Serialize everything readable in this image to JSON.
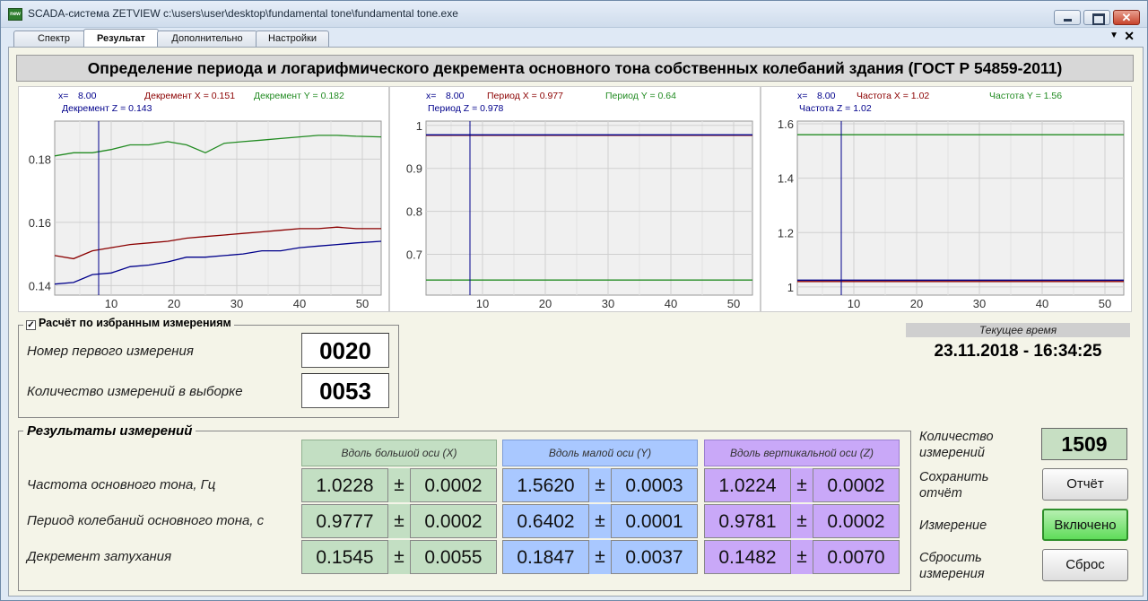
{
  "window": {
    "title": "SCADA-система ZETVIEW c:\\users\\user\\desktop\\fundamental tone\\fundamental tone.exe",
    "app_icon": "new"
  },
  "tabs": [
    {
      "label": "Спектр"
    },
    {
      "label": "Результат"
    },
    {
      "label": "Дополнительно"
    },
    {
      "label": "Настройки"
    }
  ],
  "active_tab": 1,
  "header": {
    "title": "Определение периода и логарифмического декремента основного тона собственных колебаний здания (ГОСТ Р 54859-2011)"
  },
  "colors": {
    "x": "#8b0000",
    "y": "#228b22",
    "z": "#00008b",
    "x_bg": "#c3dfc3",
    "y_bg": "#a9c8ff",
    "z_bg": "#c9a8f8"
  },
  "chart_data": [
    {
      "type": "line",
      "annotations": [
        "x=",
        "8.00",
        "Декремент X = 0.151",
        "Декремент Y = 0.182",
        "Декремент Z = 0.143"
      ],
      "cursor_x": 8,
      "xlim": [
        1,
        53
      ],
      "ylim": [
        0.137,
        0.192
      ],
      "xticks": [
        10,
        20,
        30,
        40,
        50
      ],
      "yticks": [
        0.14,
        0.16,
        0.18
      ],
      "ytick_labels": [
        "0.14",
        "0.16",
        "0.18"
      ],
      "x": [
        1,
        4,
        7,
        10,
        13,
        16,
        19,
        22,
        25,
        28,
        31,
        34,
        37,
        40,
        43,
        46,
        49,
        53
      ],
      "series": [
        {
          "name": "Декремент X",
          "color": "#8b0000",
          "values": [
            0.1495,
            0.1485,
            0.151,
            0.152,
            0.153,
            0.1535,
            0.154,
            0.155,
            0.1555,
            0.156,
            0.1565,
            0.157,
            0.1575,
            0.158,
            0.158,
            0.1585,
            0.158,
            0.158
          ]
        },
        {
          "name": "Декремент Y",
          "color": "#228b22",
          "values": [
            0.181,
            0.182,
            0.182,
            0.183,
            0.1845,
            0.1845,
            0.1855,
            0.1845,
            0.182,
            0.185,
            0.1855,
            0.186,
            0.1865,
            0.187,
            0.1875,
            0.1875,
            0.1872,
            0.187
          ]
        },
        {
          "name": "Декремент Z",
          "color": "#00008b",
          "values": [
            0.1405,
            0.141,
            0.1435,
            0.144,
            0.146,
            0.1465,
            0.1475,
            0.149,
            0.149,
            0.1495,
            0.15,
            0.151,
            0.151,
            0.152,
            0.1525,
            0.153,
            0.1535,
            0.154
          ]
        }
      ]
    },
    {
      "type": "line",
      "annotations": [
        "x=",
        "8.00",
        "Период X = 0.977",
        "Период Y = 0.64",
        "Период Z = 0.978"
      ],
      "cursor_x": 8,
      "xlim": [
        1,
        53
      ],
      "ylim": [
        0.605,
        1.01
      ],
      "xticks": [
        10,
        20,
        30,
        40,
        50
      ],
      "yticks": [
        0.7,
        0.8,
        0.9,
        1
      ],
      "ytick_labels": [
        "0.7",
        "0.8",
        "0.9",
        "1"
      ],
      "x": [
        1,
        53
      ],
      "series": [
        {
          "name": "Период X",
          "color": "#8b0000",
          "values": [
            0.977,
            0.977
          ]
        },
        {
          "name": "Период Y",
          "color": "#228b22",
          "values": [
            0.64,
            0.64
          ]
        },
        {
          "name": "Период Z",
          "color": "#00008b",
          "values": [
            0.978,
            0.978
          ]
        }
      ]
    },
    {
      "type": "line",
      "annotations": [
        "x=",
        "8.00",
        "Частота X = 1.02",
        "Частота Y = 1.56",
        "Частота Z = 1.02"
      ],
      "cursor_x": 8,
      "xlim": [
        1,
        53
      ],
      "ylim": [
        0.97,
        1.61
      ],
      "xticks": [
        10,
        20,
        30,
        40,
        50
      ],
      "yticks": [
        1,
        1.2,
        1.4,
        1.6
      ],
      "ytick_labels": [
        "1",
        "1.2",
        "1.4",
        "1.6"
      ],
      "x": [
        1,
        53
      ],
      "series": [
        {
          "name": "Частота X",
          "color": "#8b0000",
          "values": [
            1.02,
            1.02
          ]
        },
        {
          "name": "Частота Y",
          "color": "#228b22",
          "values": [
            1.56,
            1.56
          ]
        },
        {
          "name": "Частота Z",
          "color": "#00008b",
          "values": [
            1.025,
            1.025
          ]
        }
      ]
    }
  ],
  "selection": {
    "checkbox_label": "Расчёт по избранным измерениям",
    "checked": true,
    "first_label": "Номер первого измерения",
    "first_value": "0020",
    "count_label": "Количество измерений в выборке",
    "count_value": "0053"
  },
  "time": {
    "label": "Текущее время",
    "value": "23.11.2018 - 16:34:25"
  },
  "results": {
    "title": "Результаты измерений",
    "columns": [
      "Вдоль большой оси (X)",
      "Вдоль малой оси (Y)",
      "Вдоль вертикальной оси (Z)"
    ],
    "pm": "±",
    "rows": [
      {
        "label": "Частота основного тона, Гц",
        "values": [
          [
            "1.0228",
            "0.0002"
          ],
          [
            "1.5620",
            "0.0003"
          ],
          [
            "1.0224",
            "0.0002"
          ]
        ]
      },
      {
        "label": "Период колебаний основного тона, с",
        "values": [
          [
            "0.9777",
            "0.0002"
          ],
          [
            "0.6402",
            "0.0001"
          ],
          [
            "0.9781",
            "0.0002"
          ]
        ]
      },
      {
        "label": "Декремент затухания",
        "values": [
          [
            "0.1545",
            "0.0055"
          ],
          [
            "0.1847",
            "0.0037"
          ],
          [
            "0.1482",
            "0.0070"
          ]
        ]
      }
    ]
  },
  "side": {
    "count_label_1": "Количество",
    "count_label_2": "измерений",
    "count_value": "1509",
    "save_label_1": "Сохранить",
    "save_label_2": "отчёт",
    "report_button": "Отчёт",
    "measure_label": "Измерение",
    "measure_button": "Включено",
    "reset_label_1": "Сбросить",
    "reset_label_2": "измерения",
    "reset_button": "Сброс"
  }
}
